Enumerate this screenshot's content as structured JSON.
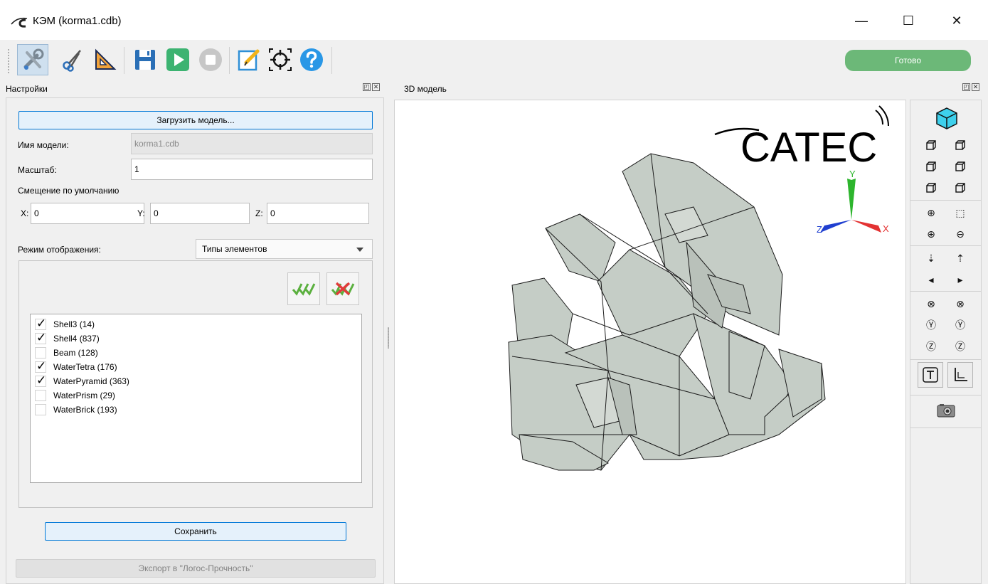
{
  "window": {
    "title": "КЭМ (korma1.cdb)",
    "minimize_glyph": "—",
    "maximize_glyph": "☐",
    "close_glyph": "✕"
  },
  "toolbar": {
    "items": [
      "settings-icon",
      "cut-icon",
      "ruler-icon",
      "save-icon",
      "run-icon",
      "stop-icon",
      "edit-icon",
      "target-icon",
      "help-icon"
    ],
    "status": "Готово",
    "status_color": "#6cb878"
  },
  "settings_panel": {
    "title": "Настройки",
    "load_model_button": "Загрузить модель...",
    "model_name_label": "Имя модели:",
    "model_name_value": "korma1.cdb",
    "scale_label": "Масштаб:",
    "scale_value": "1",
    "offset_group_label": "Смещение по умолчанию",
    "offset": {
      "x_label": "X:",
      "x_value": "0",
      "y_label": "Y:",
      "y_value": "0",
      "z_label": "Z:",
      "z_value": "0"
    },
    "display_mode_label": "Режим отображения:",
    "display_mode_value": "Типы элементов",
    "element_types": [
      {
        "label": "Shell3 (14)",
        "checked": true
      },
      {
        "label": "Shell4 (837)",
        "checked": true
      },
      {
        "label": "Beam (128)",
        "checked": false
      },
      {
        "label": "WaterTetra (176)",
        "checked": true
      },
      {
        "label": "WaterPyramid (363)",
        "checked": true
      },
      {
        "label": "WaterPrism (29)",
        "checked": false
      },
      {
        "label": "WaterBrick (193)",
        "checked": false
      }
    ],
    "save_button": "Сохранить",
    "export_button": "Экспорт в \"Логос-Прочность\""
  },
  "model_view": {
    "title": "3D модель",
    "logo_text": "CATEC",
    "axis_labels": {
      "x": "X",
      "y": "Y",
      "z": "Z"
    },
    "model_fill": "#c5cdc6"
  },
  "view_tools": {
    "items": [
      "iso-view-icon",
      "front-view-icon",
      "back-view-icon",
      "left-view-icon",
      "right-view-icon",
      "top-view-icon",
      "bottom-view-icon",
      "zoom-fit-icon",
      "zoom-region-icon",
      "zoom-in-icon",
      "zoom-out-icon",
      "pan-down-icon",
      "pan-up-icon",
      "pan-left-icon",
      "pan-right-icon",
      "rotate-x-ccw-icon",
      "rotate-x-cw-icon",
      "rotate-y-ccw-icon",
      "rotate-y-cw-icon",
      "rotate-z-ccw-icon",
      "rotate-z-cw-icon",
      "text-toggle-icon",
      "axes-toggle-icon",
      "screenshot-icon"
    ]
  }
}
